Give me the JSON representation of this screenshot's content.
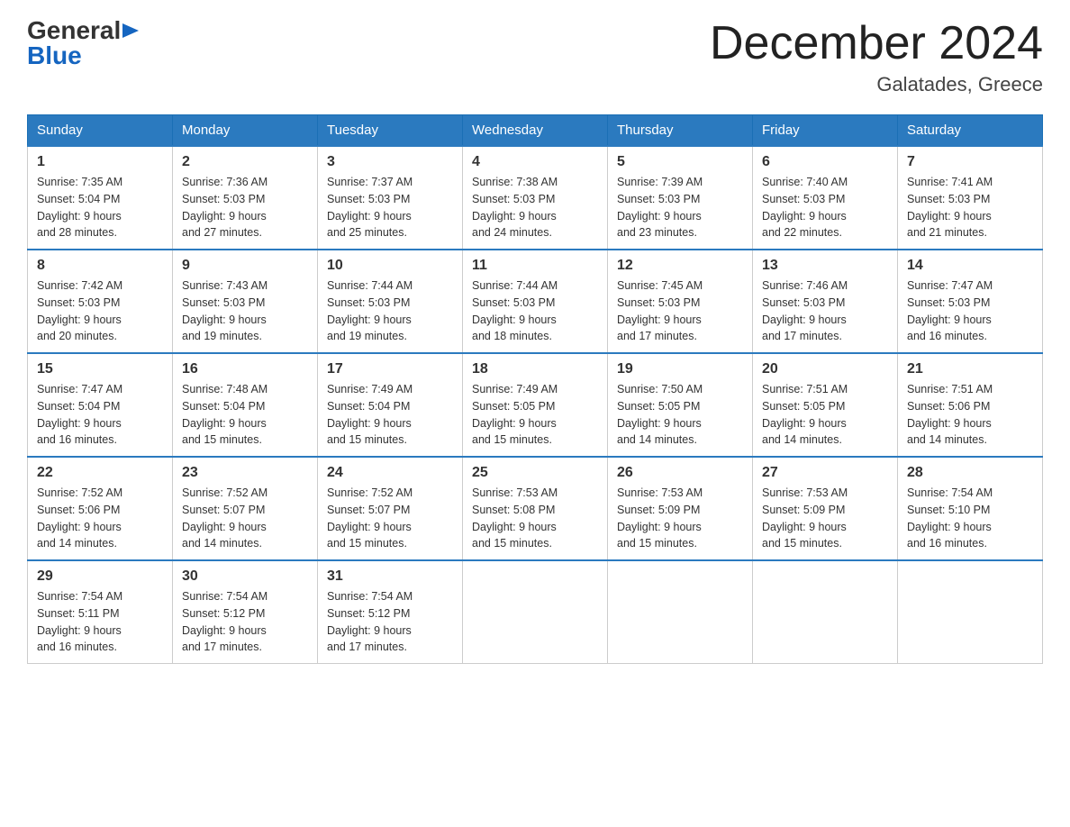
{
  "logo": {
    "general": "General",
    "blue": "Blue"
  },
  "title": "December 2024",
  "subtitle": "Galatades, Greece",
  "days_of_week": [
    "Sunday",
    "Monday",
    "Tuesday",
    "Wednesday",
    "Thursday",
    "Friday",
    "Saturday"
  ],
  "weeks": [
    [
      {
        "num": "1",
        "sunrise": "Sunrise: 7:35 AM",
        "sunset": "Sunset: 5:04 PM",
        "daylight": "Daylight: 9 hours",
        "daylight2": "and 28 minutes."
      },
      {
        "num": "2",
        "sunrise": "Sunrise: 7:36 AM",
        "sunset": "Sunset: 5:03 PM",
        "daylight": "Daylight: 9 hours",
        "daylight2": "and 27 minutes."
      },
      {
        "num": "3",
        "sunrise": "Sunrise: 7:37 AM",
        "sunset": "Sunset: 5:03 PM",
        "daylight": "Daylight: 9 hours",
        "daylight2": "and 25 minutes."
      },
      {
        "num": "4",
        "sunrise": "Sunrise: 7:38 AM",
        "sunset": "Sunset: 5:03 PM",
        "daylight": "Daylight: 9 hours",
        "daylight2": "and 24 minutes."
      },
      {
        "num": "5",
        "sunrise": "Sunrise: 7:39 AM",
        "sunset": "Sunset: 5:03 PM",
        "daylight": "Daylight: 9 hours",
        "daylight2": "and 23 minutes."
      },
      {
        "num": "6",
        "sunrise": "Sunrise: 7:40 AM",
        "sunset": "Sunset: 5:03 PM",
        "daylight": "Daylight: 9 hours",
        "daylight2": "and 22 minutes."
      },
      {
        "num": "7",
        "sunrise": "Sunrise: 7:41 AM",
        "sunset": "Sunset: 5:03 PM",
        "daylight": "Daylight: 9 hours",
        "daylight2": "and 21 minutes."
      }
    ],
    [
      {
        "num": "8",
        "sunrise": "Sunrise: 7:42 AM",
        "sunset": "Sunset: 5:03 PM",
        "daylight": "Daylight: 9 hours",
        "daylight2": "and 20 minutes."
      },
      {
        "num": "9",
        "sunrise": "Sunrise: 7:43 AM",
        "sunset": "Sunset: 5:03 PM",
        "daylight": "Daylight: 9 hours",
        "daylight2": "and 19 minutes."
      },
      {
        "num": "10",
        "sunrise": "Sunrise: 7:44 AM",
        "sunset": "Sunset: 5:03 PM",
        "daylight": "Daylight: 9 hours",
        "daylight2": "and 19 minutes."
      },
      {
        "num": "11",
        "sunrise": "Sunrise: 7:44 AM",
        "sunset": "Sunset: 5:03 PM",
        "daylight": "Daylight: 9 hours",
        "daylight2": "and 18 minutes."
      },
      {
        "num": "12",
        "sunrise": "Sunrise: 7:45 AM",
        "sunset": "Sunset: 5:03 PM",
        "daylight": "Daylight: 9 hours",
        "daylight2": "and 17 minutes."
      },
      {
        "num": "13",
        "sunrise": "Sunrise: 7:46 AM",
        "sunset": "Sunset: 5:03 PM",
        "daylight": "Daylight: 9 hours",
        "daylight2": "and 17 minutes."
      },
      {
        "num": "14",
        "sunrise": "Sunrise: 7:47 AM",
        "sunset": "Sunset: 5:03 PM",
        "daylight": "Daylight: 9 hours",
        "daylight2": "and 16 minutes."
      }
    ],
    [
      {
        "num": "15",
        "sunrise": "Sunrise: 7:47 AM",
        "sunset": "Sunset: 5:04 PM",
        "daylight": "Daylight: 9 hours",
        "daylight2": "and 16 minutes."
      },
      {
        "num": "16",
        "sunrise": "Sunrise: 7:48 AM",
        "sunset": "Sunset: 5:04 PM",
        "daylight": "Daylight: 9 hours",
        "daylight2": "and 15 minutes."
      },
      {
        "num": "17",
        "sunrise": "Sunrise: 7:49 AM",
        "sunset": "Sunset: 5:04 PM",
        "daylight": "Daylight: 9 hours",
        "daylight2": "and 15 minutes."
      },
      {
        "num": "18",
        "sunrise": "Sunrise: 7:49 AM",
        "sunset": "Sunset: 5:05 PM",
        "daylight": "Daylight: 9 hours",
        "daylight2": "and 15 minutes."
      },
      {
        "num": "19",
        "sunrise": "Sunrise: 7:50 AM",
        "sunset": "Sunset: 5:05 PM",
        "daylight": "Daylight: 9 hours",
        "daylight2": "and 14 minutes."
      },
      {
        "num": "20",
        "sunrise": "Sunrise: 7:51 AM",
        "sunset": "Sunset: 5:05 PM",
        "daylight": "Daylight: 9 hours",
        "daylight2": "and 14 minutes."
      },
      {
        "num": "21",
        "sunrise": "Sunrise: 7:51 AM",
        "sunset": "Sunset: 5:06 PM",
        "daylight": "Daylight: 9 hours",
        "daylight2": "and 14 minutes."
      }
    ],
    [
      {
        "num": "22",
        "sunrise": "Sunrise: 7:52 AM",
        "sunset": "Sunset: 5:06 PM",
        "daylight": "Daylight: 9 hours",
        "daylight2": "and 14 minutes."
      },
      {
        "num": "23",
        "sunrise": "Sunrise: 7:52 AM",
        "sunset": "Sunset: 5:07 PM",
        "daylight": "Daylight: 9 hours",
        "daylight2": "and 14 minutes."
      },
      {
        "num": "24",
        "sunrise": "Sunrise: 7:52 AM",
        "sunset": "Sunset: 5:07 PM",
        "daylight": "Daylight: 9 hours",
        "daylight2": "and 15 minutes."
      },
      {
        "num": "25",
        "sunrise": "Sunrise: 7:53 AM",
        "sunset": "Sunset: 5:08 PM",
        "daylight": "Daylight: 9 hours",
        "daylight2": "and 15 minutes."
      },
      {
        "num": "26",
        "sunrise": "Sunrise: 7:53 AM",
        "sunset": "Sunset: 5:09 PM",
        "daylight": "Daylight: 9 hours",
        "daylight2": "and 15 minutes."
      },
      {
        "num": "27",
        "sunrise": "Sunrise: 7:53 AM",
        "sunset": "Sunset: 5:09 PM",
        "daylight": "Daylight: 9 hours",
        "daylight2": "and 15 minutes."
      },
      {
        "num": "28",
        "sunrise": "Sunrise: 7:54 AM",
        "sunset": "Sunset: 5:10 PM",
        "daylight": "Daylight: 9 hours",
        "daylight2": "and 16 minutes."
      }
    ],
    [
      {
        "num": "29",
        "sunrise": "Sunrise: 7:54 AM",
        "sunset": "Sunset: 5:11 PM",
        "daylight": "Daylight: 9 hours",
        "daylight2": "and 16 minutes."
      },
      {
        "num": "30",
        "sunrise": "Sunrise: 7:54 AM",
        "sunset": "Sunset: 5:12 PM",
        "daylight": "Daylight: 9 hours",
        "daylight2": "and 17 minutes."
      },
      {
        "num": "31",
        "sunrise": "Sunrise: 7:54 AM",
        "sunset": "Sunset: 5:12 PM",
        "daylight": "Daylight: 9 hours",
        "daylight2": "and 17 minutes."
      },
      {
        "num": "",
        "sunrise": "",
        "sunset": "",
        "daylight": "",
        "daylight2": ""
      },
      {
        "num": "",
        "sunrise": "",
        "sunset": "",
        "daylight": "",
        "daylight2": ""
      },
      {
        "num": "",
        "sunrise": "",
        "sunset": "",
        "daylight": "",
        "daylight2": ""
      },
      {
        "num": "",
        "sunrise": "",
        "sunset": "",
        "daylight": "",
        "daylight2": ""
      }
    ]
  ]
}
